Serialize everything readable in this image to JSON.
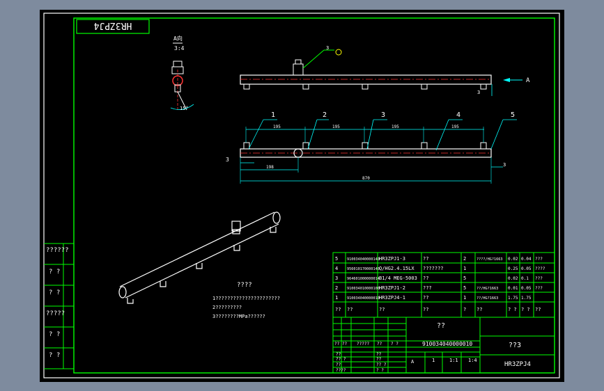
{
  "drawing": {
    "title_stamp": "HR3ZPJ4",
    "left_column_labels": [
      "??????",
      "? ?",
      "? ?",
      "?????",
      "? ?",
      "? ?"
    ],
    "section_label_top": "A向",
    "section_label_bottom": "3:4",
    "detail_angle": "15°",
    "balloon_label": "3",
    "view_arrow_label": "A",
    "callouts": [
      "1",
      "2",
      "3",
      "4",
      "5"
    ],
    "left_offset_label": "3",
    "right_offset_label": "3",
    "pitch_dims": [
      "195",
      "195",
      "195",
      "195"
    ],
    "first_pitch_dim": "198",
    "overall_length": "870",
    "notes": {
      "heading": "????",
      "lines": [
        "1??????????????????????",
        "2?????????",
        "3????????MPa??????"
      ]
    },
    "bom": {
      "rows": [
        {
          "no": "5",
          "code": "910034040000140",
          "name": "HR3ZPJ1-3",
          "mat": "??",
          "qty": "2",
          "spec": "????/HG?1663",
          "w1": "0.02",
          "w2": "0.04",
          "note": "???"
        },
        {
          "no": "4",
          "code": "956010170000140",
          "name": "Q/HG2.4.15LX",
          "mat": "???????",
          "qty": "1",
          "spec": "",
          "w1": "0.25",
          "w2": "0.05",
          "note": "????"
        },
        {
          "no": "3",
          "code": "964601000000014",
          "name": "B1/4 MEG-5003",
          "mat": "??",
          "qty": "5",
          "spec": "",
          "w1": "0.02",
          "w2": "0.1",
          "note": "???"
        },
        {
          "no": "2",
          "code": "910034010000100",
          "name": "HR3ZPJ1-2",
          "mat": "???",
          "qty": "5",
          "spec": "??/HG?1663",
          "w1": "0.01",
          "w2": "0.05",
          "note": "???"
        },
        {
          "no": "1",
          "code": "910034040000010",
          "name": "HR3ZPJ4-1",
          "mat": "??",
          "qty": "1",
          "spec": "??/HG?1663",
          "w1": "1.75",
          "w2": "1.75",
          "note": ""
        }
      ],
      "header": [
        "??",
        "??",
        "??",
        "??",
        "?",
        "??",
        "? ?",
        "? ?",
        "??"
      ]
    },
    "title_block": {
      "part_name": "??",
      "drawing_code": "910034040000010",
      "company": "??3",
      "drawing_no": "HR3ZPJ4",
      "scale_label": "A",
      "sheet_count": "1",
      "scale_value": "1:1",
      "weight_value": "1:4",
      "sign_labels": [
        "?? ??",
        "?????",
        "??",
        "? ?",
        "? ?",
        "??",
        "? ?",
        "???"
      ],
      "row_labels": [
        "??",
        "??",
        "?? ?",
        "??",
        "??",
        "?? ?",
        "????"
      ]
    }
  }
}
